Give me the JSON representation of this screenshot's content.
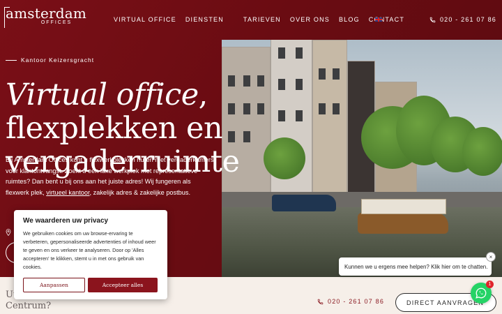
{
  "brand": {
    "name": "amsterdam",
    "sub": "OFFICES"
  },
  "nav": {
    "items": [
      "VIRTUAL OFFICE",
      "DIENSTEN",
      "TARIEVEN",
      "OVER ONS",
      "BLOG",
      "CONTACT"
    ],
    "language_icon": "uk-flag-icon"
  },
  "header": {
    "phone": "020 - 261 07 86"
  },
  "hero": {
    "kicker": "Kantoor Keizersgracht",
    "headline_italic": "Virtual office",
    "headline_rest": ", flexplekken en vergaderruimte",
    "intro_1": "Bij Amsterdam Offices kunt u flexwerkplekken huren met vergaderkamers voor klantontvangst. Zoekt u een luxe werkplek met representatieve ruimtes? Dan bent u bij ons aan het juiste adres! Wij fungeren als flexwerk plek, ",
    "intro_link": "virtueel kantoor",
    "intro_2": ", zakelijk adres & zakelijke postbus."
  },
  "bottom": {
    "question_line1": "Uw",
    "question_line2": "Centrum?",
    "phone": "020 - 261 07 86",
    "cta": "DIRECT AANVRAGEN"
  },
  "cookie": {
    "title": "We waarderen uw privacy",
    "body": "We gebruiken cookies om uw browse-ervaring te verbeteren, gepersonaliseerde advertenties of inhoud weer te geven en ons verkeer te analyseren. Door op 'Alles accepteren' te klikken, stemt u in met ons gebruik van cookies.",
    "customize": "Aanpassen",
    "accept": "Accepteer alles"
  },
  "chat": {
    "message": "Kunnen we u ergens mee helpen? Klik hier om te chatten.",
    "close": "×",
    "badge": "1"
  },
  "colors": {
    "brand": "#7a0f17",
    "whatsapp": "#25d366"
  }
}
